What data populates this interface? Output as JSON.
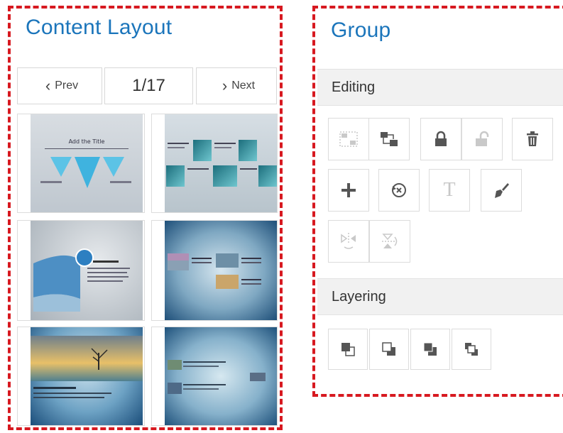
{
  "content_layout": {
    "title": "Content Layout",
    "pager": {
      "prev_label": "Prev",
      "next_label": "Next",
      "page_indicator": "1/17"
    },
    "thumbnails": [
      {
        "icon": "slide-thumbnail-icon",
        "title_text": "Add the Title"
      },
      {
        "icon": "slide-thumbnail-icon"
      },
      {
        "icon": "slide-thumbnail-icon"
      },
      {
        "icon": "slide-thumbnail-icon"
      },
      {
        "icon": "slide-thumbnail-icon"
      },
      {
        "icon": "slide-thumbnail-icon"
      }
    ]
  },
  "group": {
    "title": "Group",
    "editing": {
      "label": "Editing",
      "tools": [
        {
          "icon": "group-icon",
          "enabled": false
        },
        {
          "icon": "ungroup-icon",
          "enabled": true
        },
        {
          "icon": "lock-icon",
          "enabled": true
        },
        {
          "icon": "unlock-icon",
          "enabled": false
        },
        {
          "icon": "delete-icon",
          "enabled": true
        },
        {
          "icon": "add-icon",
          "enabled": true
        },
        {
          "icon": "reset-rotation-icon",
          "enabled": true
        },
        {
          "icon": "text-icon",
          "enabled": false
        },
        {
          "icon": "format-painter-icon",
          "enabled": true
        },
        {
          "icon": "flip-horizontal-icon",
          "enabled": false
        },
        {
          "icon": "flip-vertical-icon",
          "enabled": false
        }
      ]
    },
    "layering": {
      "label": "Layering",
      "tools": [
        {
          "icon": "bring-to-front-icon"
        },
        {
          "icon": "send-to-back-icon"
        },
        {
          "icon": "bring-forward-icon"
        },
        {
          "icon": "send-backward-icon"
        }
      ]
    }
  },
  "colors": {
    "accent_title": "#1b75bb",
    "frame_dash": "#d71920",
    "disabled_icon": "#c8c8c8",
    "enabled_icon": "#555555"
  }
}
